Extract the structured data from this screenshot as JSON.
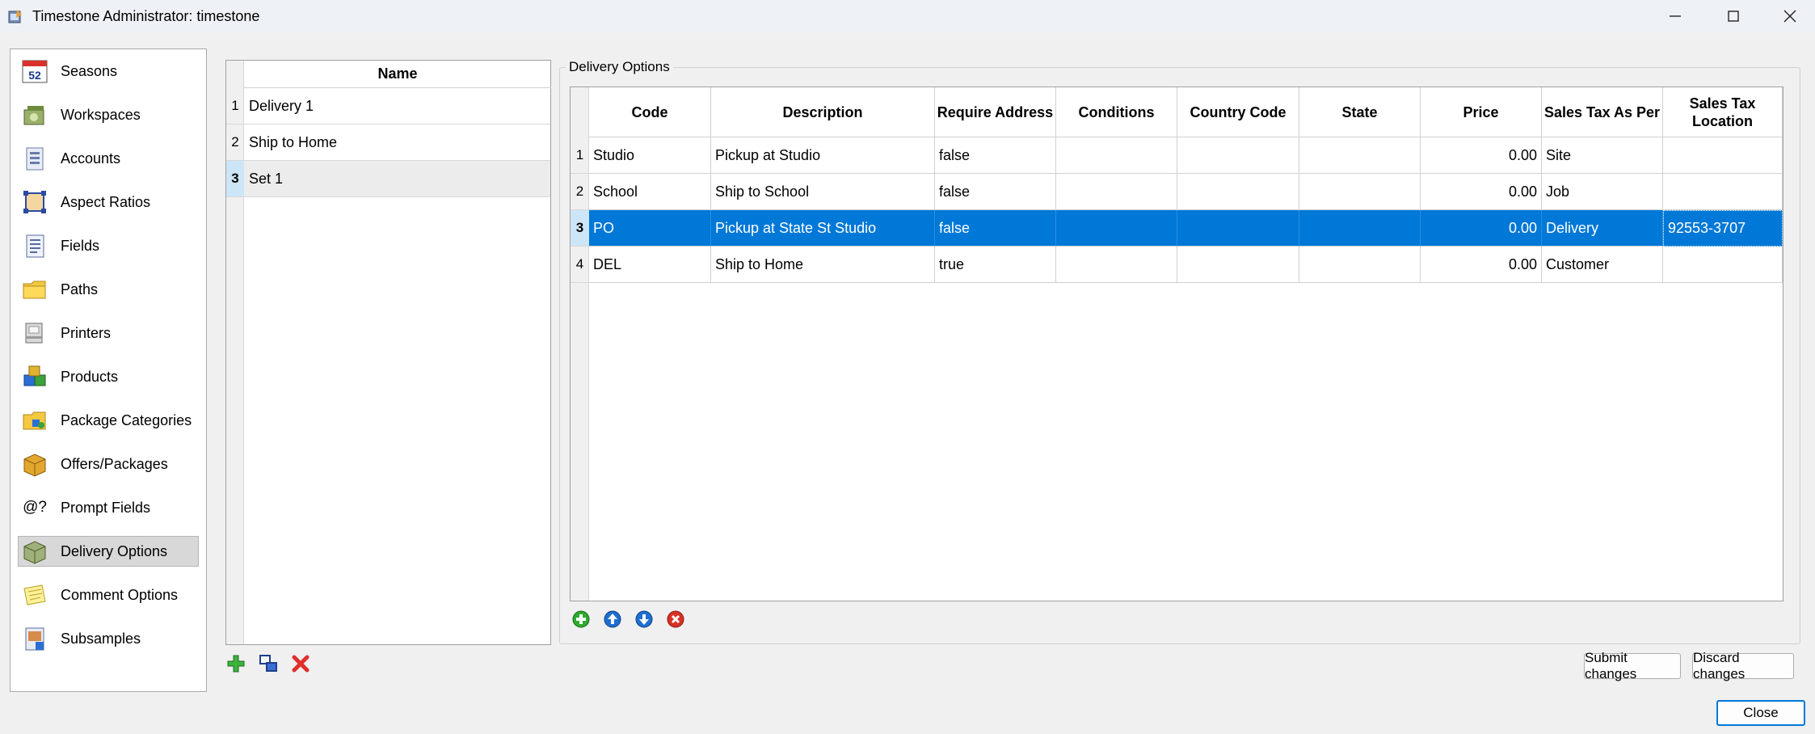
{
  "window": {
    "title": "Timestone Administrator: timestone",
    "minimize_label": "—",
    "maximize_label": "☐",
    "close_label": "✕"
  },
  "nav": {
    "items": [
      {
        "label": "Seasons",
        "icon": "calendar-icon"
      },
      {
        "label": "Workspaces",
        "icon": "workspaces-icon"
      },
      {
        "label": "Accounts",
        "icon": "accounts-icon"
      },
      {
        "label": "Aspect Ratios",
        "icon": "aspect-ratio-icon"
      },
      {
        "label": "Fields",
        "icon": "fields-icon"
      },
      {
        "label": "Paths",
        "icon": "folder-icon"
      },
      {
        "label": "Printers",
        "icon": "printer-icon"
      },
      {
        "label": "Products",
        "icon": "products-icon"
      },
      {
        "label": "Package Categories",
        "icon": "package-categories-icon"
      },
      {
        "label": "Offers/Packages",
        "icon": "package-icon"
      },
      {
        "label": "Prompt Fields",
        "icon": "prompt-fields-icon"
      },
      {
        "label": "Delivery Options",
        "icon": "delivery-box-icon"
      },
      {
        "label": "Comment Options",
        "icon": "comment-note-icon"
      },
      {
        "label": "Subsamples",
        "icon": "subsamples-icon"
      }
    ],
    "active": "Delivery Options",
    "calendar_number": "52",
    "prompt_glyph": "@?"
  },
  "namelist": {
    "header": "Name",
    "rows": [
      {
        "num": "1",
        "name": "Delivery 1"
      },
      {
        "num": "2",
        "name": "Ship to Home"
      },
      {
        "num": "3",
        "name": "Set 1"
      }
    ],
    "selected_row": "3"
  },
  "delivery": {
    "group_title": "Delivery Options",
    "columns": {
      "code": "Code",
      "description": "Description",
      "require_address": "Require Address",
      "conditions": "Conditions",
      "country_code": "Country Code",
      "state": "State",
      "price": "Price",
      "sales_tax_as_per": "Sales Tax As Per",
      "sales_tax_location": "Sales Tax Location"
    },
    "rows": [
      {
        "num": "1",
        "code": "Studio",
        "description": "Pickup at Studio",
        "require_address": "false",
        "conditions": "",
        "country_code": "",
        "state": "",
        "price": "0.00",
        "sales_tax_as_per": "Site",
        "sales_tax_location": ""
      },
      {
        "num": "2",
        "code": "School",
        "description": "Ship to School",
        "require_address": "false",
        "conditions": "",
        "country_code": "",
        "state": "",
        "price": "0.00",
        "sales_tax_as_per": "Job",
        "sales_tax_location": ""
      },
      {
        "num": "3",
        "code": "PO",
        "description": "Pickup at State St Studio",
        "require_address": "false",
        "conditions": "",
        "country_code": "",
        "state": "",
        "price": "0.00",
        "sales_tax_as_per": "Delivery",
        "sales_tax_location": "92553-3707"
      },
      {
        "num": "4",
        "code": "DEL",
        "description": "Ship to Home",
        "require_address": "true",
        "conditions": "",
        "country_code": "",
        "state": "",
        "price": "0.00",
        "sales_tax_as_per": "Customer",
        "sales_tax_location": ""
      }
    ],
    "selected_row": "3"
  },
  "buttons": {
    "submit": "Submit changes",
    "discard": "Discard changes",
    "close": "Close"
  },
  "colors": {
    "selection": "#0078d7",
    "add": "#2eaa2e",
    "move": "#1e6fd1",
    "delete": "#d93025"
  }
}
